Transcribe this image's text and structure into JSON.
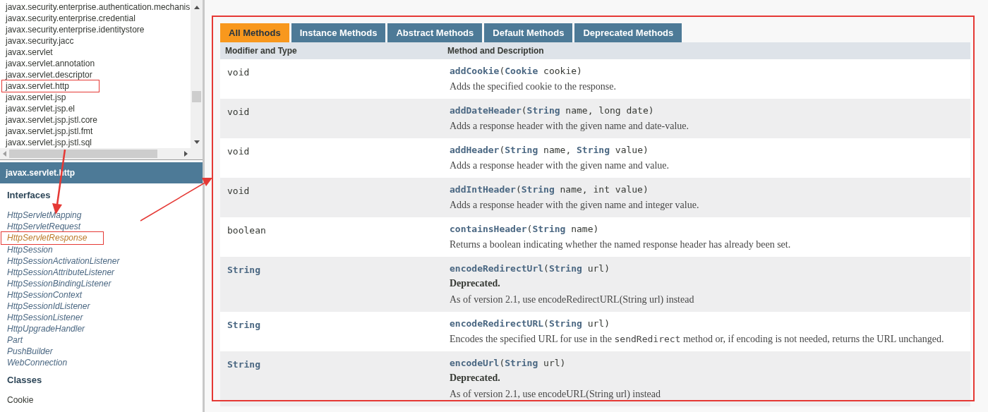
{
  "packages": [
    {
      "label": "javax.security.enterprise.authentication.mechanis",
      "annotated": false
    },
    {
      "label": "javax.security.enterprise.credential",
      "annotated": false
    },
    {
      "label": "javax.security.enterprise.identitystore",
      "annotated": false
    },
    {
      "label": "javax.security.jacc",
      "annotated": false
    },
    {
      "label": "javax.servlet",
      "annotated": false
    },
    {
      "label": "javax.servlet.annotation",
      "annotated": false
    },
    {
      "label": "javax.servlet.descriptor",
      "annotated": false
    },
    {
      "label": "javax.servlet.http",
      "annotated": true
    },
    {
      "label": "javax.servlet.jsp",
      "annotated": false
    },
    {
      "label": "javax.servlet.jsp.el",
      "annotated": false
    },
    {
      "label": "javax.servlet.jsp.jstl.core",
      "annotated": false
    },
    {
      "label": "javax.servlet.jsp.jstl.fmt",
      "annotated": false
    },
    {
      "label": "javax.servlet.jsp.jstl.sql",
      "annotated": false
    }
  ],
  "package_title": "javax.servlet.http",
  "sections": [
    {
      "heading": "Interfaces",
      "items": [
        {
          "label": "HttpServletMapping",
          "selected": false,
          "annotated": false
        },
        {
          "label": "HttpServletRequest",
          "selected": false,
          "annotated": false
        },
        {
          "label": "HttpServletResponse",
          "selected": true,
          "annotated": true
        },
        {
          "label": "HttpSession",
          "selected": false,
          "annotated": false
        },
        {
          "label": "HttpSessionActivationListener",
          "selected": false,
          "annotated": false
        },
        {
          "label": "HttpSessionAttributeListener",
          "selected": false,
          "annotated": false
        },
        {
          "label": "HttpSessionBindingListener",
          "selected": false,
          "annotated": false
        },
        {
          "label": "HttpSessionContext",
          "selected": false,
          "annotated": false
        },
        {
          "label": "HttpSessionIdListener",
          "selected": false,
          "annotated": false
        },
        {
          "label": "HttpSessionListener",
          "selected": false,
          "annotated": false
        },
        {
          "label": "HttpUpgradeHandler",
          "selected": false,
          "annotated": false
        },
        {
          "label": "Part",
          "selected": false,
          "annotated": false
        },
        {
          "label": "PushBuilder",
          "selected": false,
          "annotated": false
        },
        {
          "label": "WebConnection",
          "selected": false,
          "annotated": false
        }
      ]
    },
    {
      "heading": "Classes",
      "items": [
        {
          "label": "Cookie",
          "selected": false,
          "annotated": false
        }
      ]
    }
  ],
  "method_summary": {
    "annotated": true,
    "tabs": [
      {
        "label": "All Methods",
        "selected": true
      },
      {
        "label": "Instance Methods",
        "selected": false
      },
      {
        "label": "Abstract Methods",
        "selected": false
      },
      {
        "label": "Default Methods",
        "selected": false
      },
      {
        "label": "Deprecated Methods",
        "selected": false
      }
    ],
    "columns": [
      "Modifier and Type",
      "Method and Description"
    ],
    "rows": [
      {
        "type": "void",
        "type_link": false,
        "signature": "**addCookie**(**Cookie** cookie)",
        "deprecated": false,
        "description": [
          {
            "text": "Adds the specified cookie to the response.",
            "kind": "text"
          }
        ]
      },
      {
        "type": "void",
        "type_link": false,
        "signature": "**addDateHeader**(**String** name, long date)",
        "deprecated": false,
        "description": [
          {
            "text": "Adds a response header with the given name and date-value.",
            "kind": "text"
          }
        ]
      },
      {
        "type": "void",
        "type_link": false,
        "signature": "**addHeader**(**String** name, **String** value)",
        "deprecated": false,
        "description": [
          {
            "text": "Adds a response header with the given name and value.",
            "kind": "text"
          }
        ]
      },
      {
        "type": "void",
        "type_link": false,
        "signature": "**addIntHeader**(**String** name, int value)",
        "deprecated": false,
        "description": [
          {
            "text": "Adds a response header with the given name and integer value.",
            "kind": "text"
          }
        ]
      },
      {
        "type": "boolean",
        "type_link": false,
        "signature": "**containsHeader**(**String** name)",
        "deprecated": false,
        "description": [
          {
            "text": "Returns a boolean indicating whether the named response header has already been set.",
            "kind": "text"
          }
        ]
      },
      {
        "type": "String",
        "type_link": true,
        "signature": "**encodeRedirectUrl**(**String** url)",
        "deprecated": true,
        "deprecated_label": "Deprecated.",
        "description": [
          {
            "text": "As of version 2.1, use encodeRedirectURL(String url) instead",
            "kind": "text"
          }
        ]
      },
      {
        "type": "String",
        "type_link": true,
        "signature": "**encodeRedirectURL**(**String** url)",
        "deprecated": false,
        "description": [
          {
            "text": "Encodes the specified URL for use in the ",
            "kind": "text"
          },
          {
            "text": "sendRedirect",
            "kind": "code"
          },
          {
            "text": " method or, if encoding is not needed, returns the URL unchanged.",
            "kind": "text"
          }
        ]
      },
      {
        "type": "String",
        "type_link": true,
        "signature": "**encodeUrl**(**String** url)",
        "deprecated": true,
        "deprecated_label": "Deprecated.",
        "description": [
          {
            "text": "As of version 2.1, use encodeURL(String url) instead",
            "kind": "text"
          }
        ]
      }
    ]
  }
}
